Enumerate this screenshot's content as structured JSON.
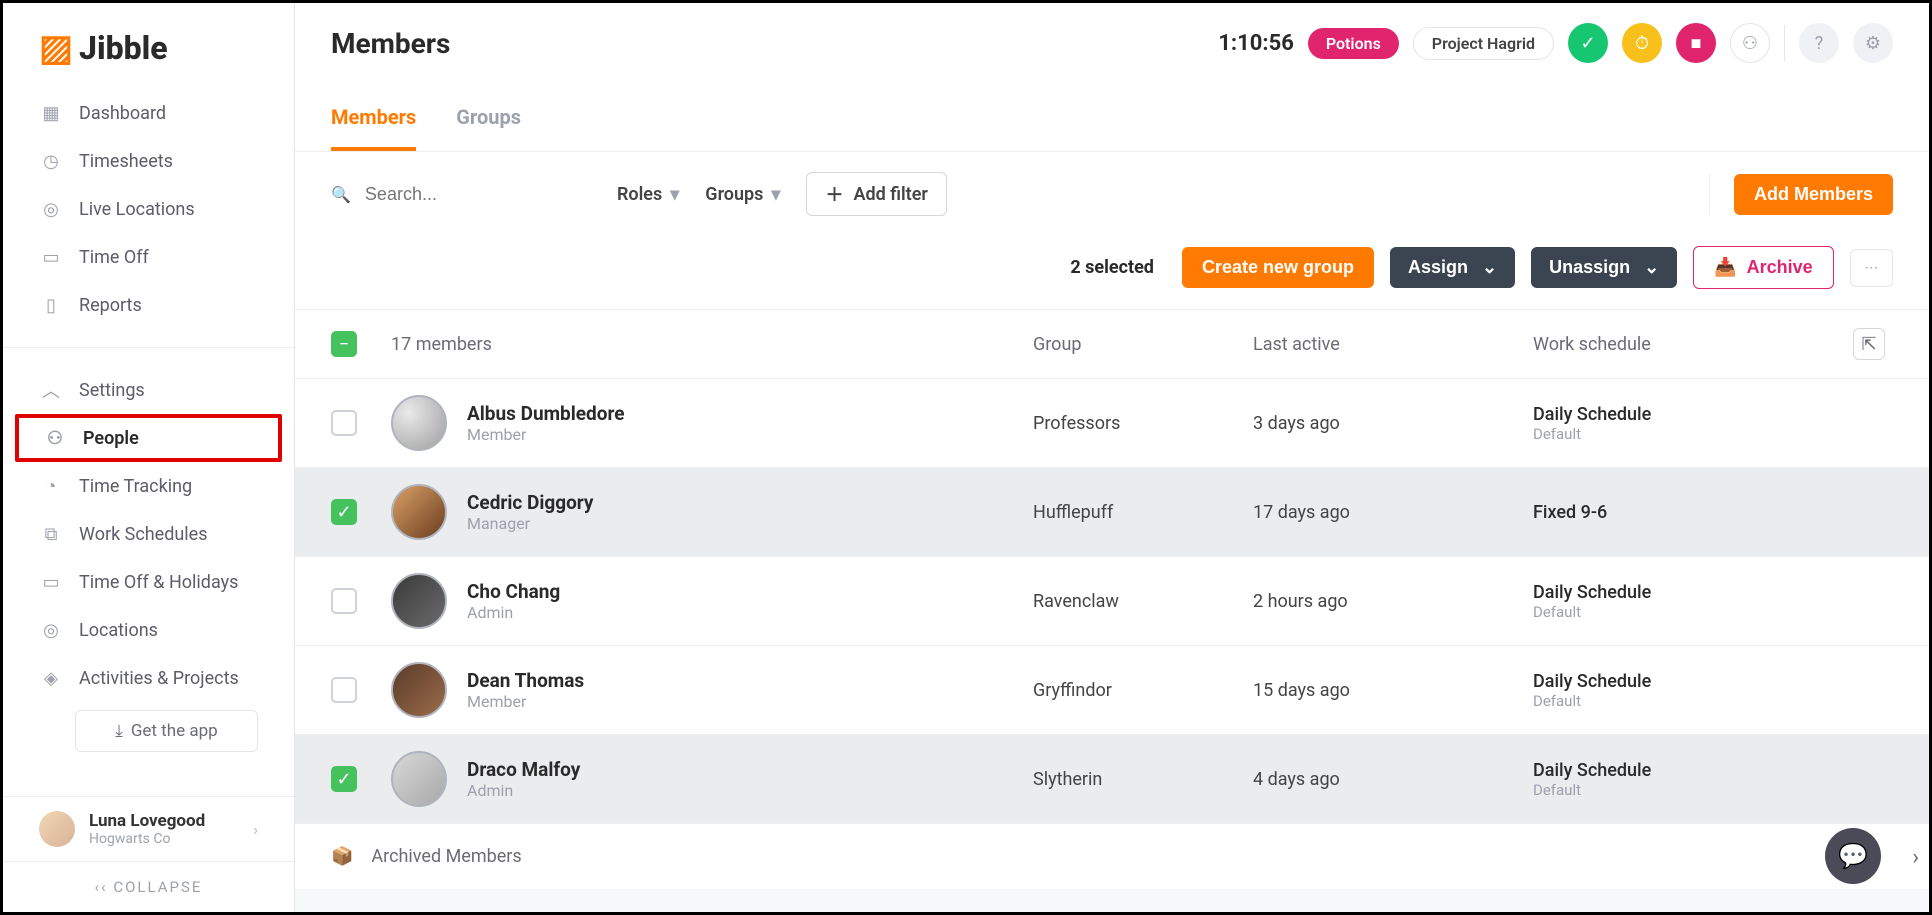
{
  "brand": "Jibble",
  "page_title": "Members",
  "header": {
    "timer": "1:10:56",
    "pill_active": "Potions",
    "pill_project": "Project Hagrid"
  },
  "sidebar": {
    "items_top": [
      {
        "label": "Dashboard"
      },
      {
        "label": "Timesheets"
      },
      {
        "label": "Live Locations"
      },
      {
        "label": "Time Off"
      },
      {
        "label": "Reports"
      }
    ],
    "items_bottom": [
      {
        "label": "Settings"
      },
      {
        "label": "People"
      },
      {
        "label": "Time Tracking"
      },
      {
        "label": "Work Schedules"
      },
      {
        "label": "Time Off & Holidays"
      },
      {
        "label": "Locations"
      },
      {
        "label": "Activities & Projects"
      }
    ],
    "get_app": "Get the app",
    "user_name": "Luna Lovegood",
    "user_org": "Hogwarts Co",
    "collapse": "COLLAPSE"
  },
  "tabs": {
    "members": "Members",
    "groups": "Groups"
  },
  "filters": {
    "search_placeholder": "Search...",
    "roles": "Roles",
    "groups": "Groups",
    "add_filter": "Add filter",
    "add_members": "Add Members"
  },
  "selection": {
    "count_text": "2 selected",
    "create_group": "Create new group",
    "assign": "Assign",
    "unassign": "Unassign",
    "archive": "Archive"
  },
  "table": {
    "count_label": "17 members",
    "col_group": "Group",
    "col_last": "Last active",
    "col_sched": "Work schedule",
    "rows": [
      {
        "name": "Albus Dumbledore",
        "role": "Member",
        "group": "Professors",
        "last": "3 days ago",
        "sched": "Daily Schedule",
        "sched_def": "Default",
        "selected": false
      },
      {
        "name": "Cedric Diggory",
        "role": "Manager",
        "group": "Hufflepuff",
        "last": "17 days ago",
        "sched": "Fixed 9-6",
        "sched_def": "",
        "selected": true
      },
      {
        "name": "Cho Chang",
        "role": "Admin",
        "group": "Ravenclaw",
        "last": "2 hours ago",
        "sched": "Daily Schedule",
        "sched_def": "Default",
        "selected": false
      },
      {
        "name": "Dean Thomas",
        "role": "Member",
        "group": "Gryffindor",
        "last": "15 days ago",
        "sched": "Daily Schedule",
        "sched_def": "Default",
        "selected": false
      },
      {
        "name": "Draco Malfoy",
        "role": "Admin",
        "group": "Slytherin",
        "last": "4 days ago",
        "sched": "Daily Schedule",
        "sched_def": "Default",
        "selected": true
      }
    ],
    "archived": "Archived Members"
  }
}
